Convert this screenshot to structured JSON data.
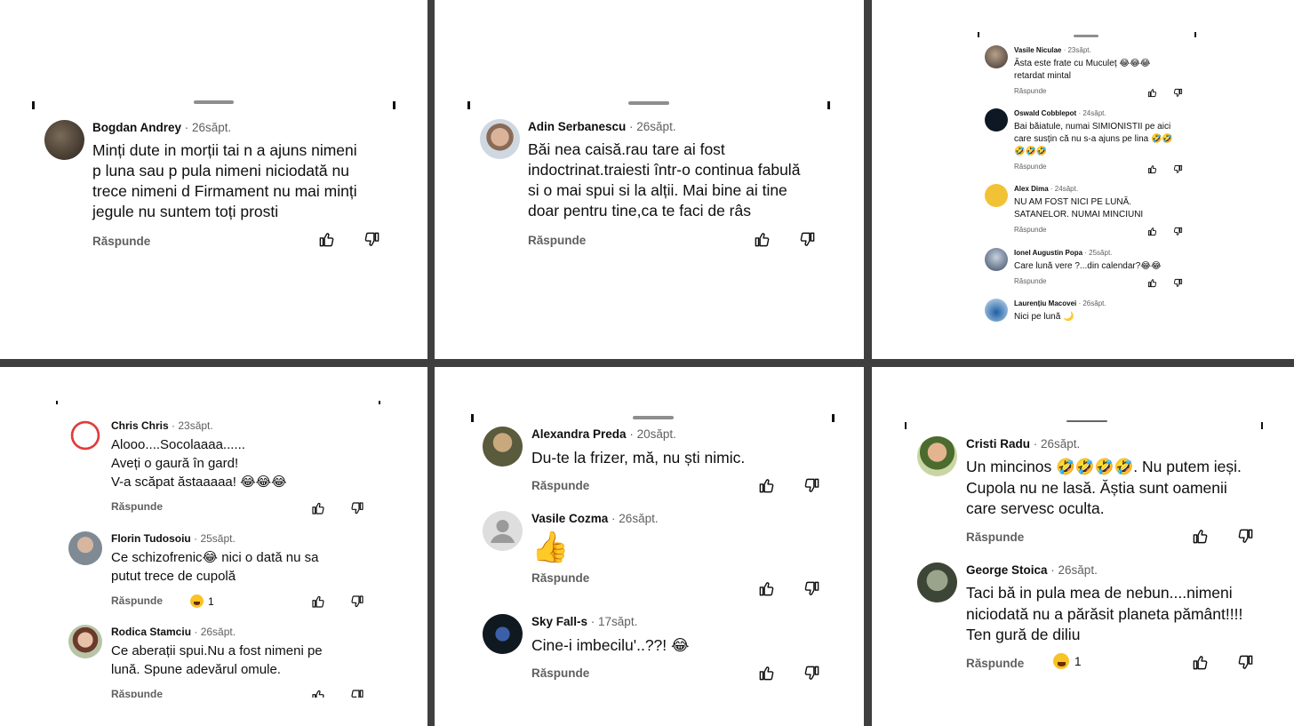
{
  "reply_label": "Răspunde",
  "panel1": {
    "author": "Bogdan Andrey",
    "time": "26săpt.",
    "text": "Minți dute in morții tai n a ajuns nimeni\np luna sau p pula nimeni niciodată nu\ntrece nimeni d Firmament nu mai minți\njegule nu suntem toți prosti"
  },
  "panel2": {
    "author": "Adin Serbanescu",
    "time": "26săpt.",
    "text": "Băi nea caisă.rau tare ai fost\nindoctrinat.traiesti într-o continua fabulă\nsi o mai spui si la alții. Mai bine ai tine\ndoar pentru tine,ca te faci de râs"
  },
  "panel3": {
    "comments": [
      {
        "author": "Vasile Niculae",
        "time": "23săpt.",
        "text": "Ăsta este frate cu Muculeț 😂😂😂\nretardat mintal"
      },
      {
        "author": "Oswald Cobblepot",
        "time": "24săpt.",
        "text": "Bai băiatule, numai SIMIONISTII pe aici\ncare susțin că nu s-a ajuns pe lina 🤣🤣\n🤣🤣🤣"
      },
      {
        "author": "Alex Dima",
        "time": "24săpt.",
        "text": "NU AM FOST NICI PE LUNĂ.\nSATANELOR. NUMAI MINCIUNI"
      },
      {
        "author": "Ionel Augustin Popa",
        "time": "25săpt.",
        "text": "Care lună vere ?...din calendar?😂😂"
      },
      {
        "author": "Laurențiu Macovei",
        "time": "26săpt.",
        "text": "Nici pe lună 🌙"
      }
    ]
  },
  "panel4": {
    "comments": [
      {
        "author": "Chris Chris",
        "time": "23săpt.",
        "text": "Alooo....Socolaaaa......\nAveți o gaură în gard!\nV-a scăpat ăstaaaaa! 😂😂😂"
      },
      {
        "author": "Florin Tudosoiu",
        "time": "25săpt.",
        "text": "Ce schizofrenic😂 nici o dată nu sa\nputut trece de cupolă",
        "reactions": "1"
      },
      {
        "author": "Rodica Stamciu",
        "time": "26săpt.",
        "text": "Ce aberații spui.Nu a fost nimeni pe\nlună. Spune adevărul omule."
      }
    ]
  },
  "panel5": {
    "comments": [
      {
        "author": "Alexandra Preda",
        "time": "20săpt.",
        "text": "Du-te la frizer, mă, nu ști nimic."
      },
      {
        "author": "Vasile Cozma",
        "time": "26săpt.",
        "text": "👍"
      },
      {
        "author": "Sky Fall-s",
        "time": "17săpt.",
        "text": "Cine-i imbecilu'..??! 😂"
      }
    ]
  },
  "panel6": {
    "comments": [
      {
        "author": "Cristi Radu",
        "time": "26săpt.",
        "text": "Un mincinos 🤣🤣🤣🤣. Nu  putem ieși.\nCupola nu ne lasă. Ăștia sunt oamenii\ncare servesc oculta."
      },
      {
        "author": "George Stoica",
        "time": "26săpt.",
        "text": "Taci bă in pula mea de nebun....nimeni\nniciodată nu a părăsit planeta pământ!!!!\nTen gură de diliu",
        "reactions": "1"
      }
    ]
  },
  "colors": {
    "background": "#3f3f3f",
    "panel": "#ffffff",
    "secondary_text": "#606060",
    "reaction_emoji": "#f7c325"
  },
  "icons": [
    "thumb-up-icon",
    "thumb-down-icon",
    "laughing-emoji-icon",
    "handle-bar"
  ]
}
